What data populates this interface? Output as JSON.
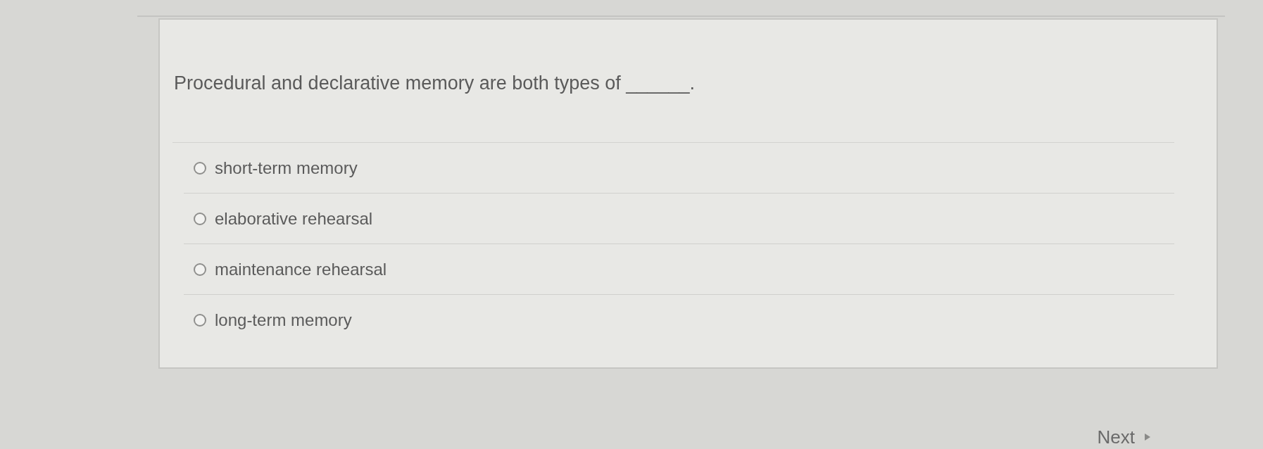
{
  "question": {
    "text": "Procedural and declarative memory are both types of ______."
  },
  "options": [
    {
      "label": "short-term memory",
      "selected": false
    },
    {
      "label": "elaborative rehearsal",
      "selected": false
    },
    {
      "label": "maintenance rehearsal",
      "selected": false
    },
    {
      "label": "long-term memory",
      "selected": false
    }
  ],
  "next_button": {
    "label": "Next"
  }
}
